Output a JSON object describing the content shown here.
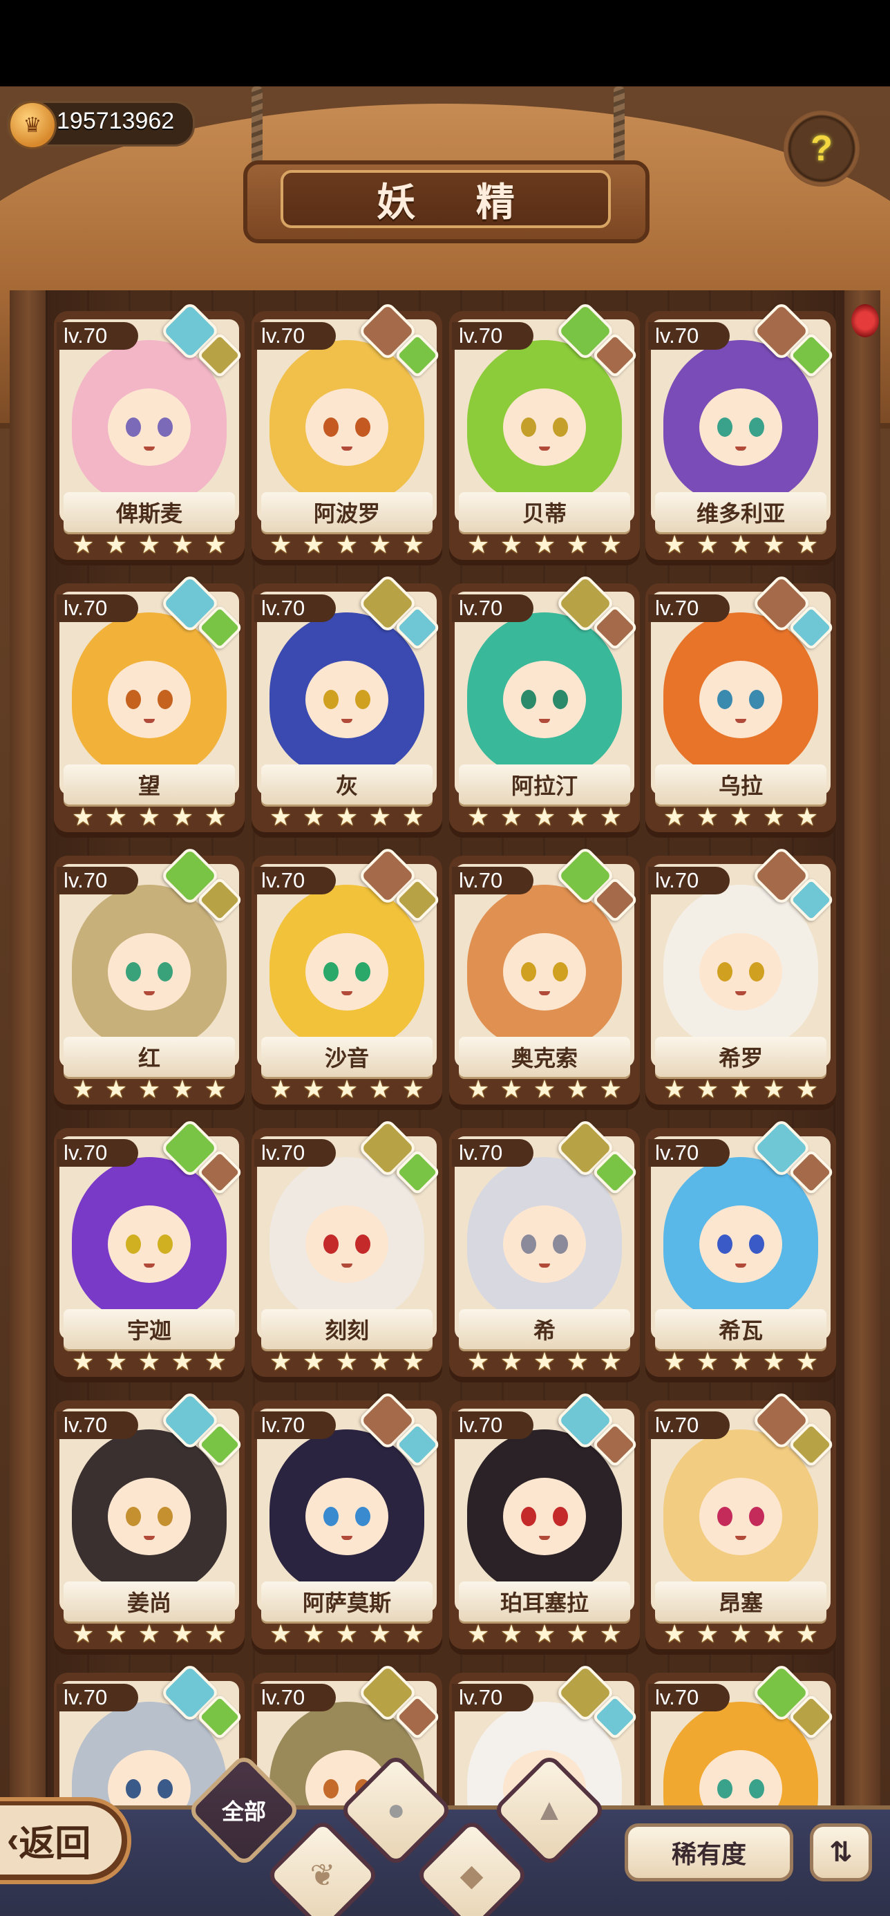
{
  "header": {
    "coins": "195713962",
    "coin_icon": "crown-coin-icon",
    "title": "妖 精",
    "help_icon": "question-sprout-icon"
  },
  "fairies": [
    {
      "name": "俾斯麦",
      "level": "lv.70",
      "stars": 5,
      "gems": [
        "water",
        "earth"
      ],
      "hair": "#f3b6c7",
      "eye": "#7a6ab8"
    },
    {
      "name": "阿波罗",
      "level": "lv.70",
      "stars": 5,
      "gems": [
        "rock",
        "plant"
      ],
      "hair": "#f0c04a",
      "eye": "#c45a22"
    },
    {
      "name": "贝蒂",
      "level": "lv.70",
      "stars": 5,
      "gems": [
        "plant",
        "rock"
      ],
      "hair": "#8ccc3a",
      "eye": "#c4a02a"
    },
    {
      "name": "维多利亚",
      "level": "lv.70",
      "stars": 5,
      "gems": [
        "rock",
        "plant"
      ],
      "hair": "#7a4cb8",
      "eye": "#3aa28a"
    },
    {
      "name": "望",
      "level": "lv.70",
      "stars": 5,
      "gems": [
        "water",
        "plant"
      ],
      "hair": "#f2b23a",
      "eye": "#c4621e"
    },
    {
      "name": "灰",
      "level": "lv.70",
      "stars": 5,
      "gems": [
        "earth",
        "water"
      ],
      "hair": "#3a4ab0",
      "eye": "#d0a020"
    },
    {
      "name": "阿拉汀",
      "level": "lv.70",
      "stars": 5,
      "gems": [
        "earth",
        "rock"
      ],
      "hair": "#3ab89a",
      "eye": "#2a8a6a"
    },
    {
      "name": "乌拉",
      "level": "lv.70",
      "stars": 5,
      "gems": [
        "rock",
        "water"
      ],
      "hair": "#e8742a",
      "eye": "#3a8ab0"
    },
    {
      "name": "红",
      "level": "lv.70",
      "stars": 5,
      "gems": [
        "plant",
        "earth"
      ],
      "hair": "#c8b07a",
      "eye": "#3aa27a"
    },
    {
      "name": "沙音",
      "level": "lv.70",
      "stars": 5,
      "gems": [
        "rock",
        "earth"
      ],
      "hair": "#f2c23a",
      "eye": "#2aa86a"
    },
    {
      "name": "奥克索",
      "level": "lv.70",
      "stars": 5,
      "gems": [
        "plant",
        "rock"
      ],
      "hair": "#e09050",
      "eye": "#d0a020"
    },
    {
      "name": "希罗",
      "level": "lv.70",
      "stars": 5,
      "gems": [
        "rock",
        "water"
      ],
      "hair": "#f4efe6",
      "eye": "#d0a020"
    },
    {
      "name": "宇迦",
      "level": "lv.70",
      "stars": 5,
      "gems": [
        "plant",
        "rock"
      ],
      "hair": "#7a3ac8",
      "eye": "#d0b020"
    },
    {
      "name": "刻刻",
      "level": "lv.70",
      "stars": 5,
      "gems": [
        "earth",
        "plant"
      ],
      "hair": "#efe9e2",
      "eye": "#c42a2a"
    },
    {
      "name": "希",
      "level": "lv.70",
      "stars": 5,
      "gems": [
        "earth",
        "plant"
      ],
      "hair": "#d8d8e0",
      "eye": "#8a8a9a"
    },
    {
      "name": "希瓦",
      "level": "lv.70",
      "stars": 5,
      "gems": [
        "water",
        "rock"
      ],
      "hair": "#5ab8e8",
      "eye": "#3a5ac8"
    },
    {
      "name": "姜尚",
      "level": "lv.70",
      "stars": 5,
      "gems": [
        "water",
        "plant"
      ],
      "hair": "#3a3030",
      "eye": "#c49030"
    },
    {
      "name": "阿萨莫斯",
      "level": "lv.70",
      "stars": 5,
      "gems": [
        "rock",
        "water"
      ],
      "hair": "#2a2440",
      "eye": "#3a8ad0"
    },
    {
      "name": "珀耳塞拉",
      "level": "lv.70",
      "stars": 5,
      "gems": [
        "water",
        "rock"
      ],
      "hair": "#2a2226",
      "eye": "#c42a2a"
    },
    {
      "name": "昂塞",
      "level": "lv.70",
      "stars": 5,
      "gems": [
        "rock",
        "earth"
      ],
      "hair": "#f2cc80",
      "eye": "#c42a5a"
    },
    {
      "name": "",
      "level": "lv.70",
      "stars": 0,
      "gems": [
        "water",
        "plant"
      ],
      "hair": "#b8c0cc",
      "eye": "#3a5a8a"
    },
    {
      "name": "",
      "level": "lv.70",
      "stars": 0,
      "gems": [
        "earth",
        "rock"
      ],
      "hair": "#9a8a5a",
      "eye": "#c46a2a"
    },
    {
      "name": "",
      "level": "lv.70",
      "stars": 0,
      "gems": [
        "earth",
        "water"
      ],
      "hair": "#f4f0ec",
      "eye": "#c42a2a"
    },
    {
      "name": "",
      "level": "lv.70",
      "stars": 0,
      "gems": [
        "plant",
        "earth"
      ],
      "hair": "#f0a830",
      "eye": "#3aa28a"
    }
  ],
  "bottom": {
    "back_label": "返回",
    "filter_all": "全部",
    "filter_icons": [
      "sprout-icon",
      "water-drop-icon",
      "rock-icon",
      "mountain-icon"
    ],
    "rarity_label": "稀有度",
    "sort_icon": "sort-order-icon"
  },
  "colors": {
    "water": "#6fc7d6",
    "plant": "#7ac445",
    "earth": "#b8a246",
    "rock": "#a56a4a",
    "frame": "#5e3620"
  }
}
